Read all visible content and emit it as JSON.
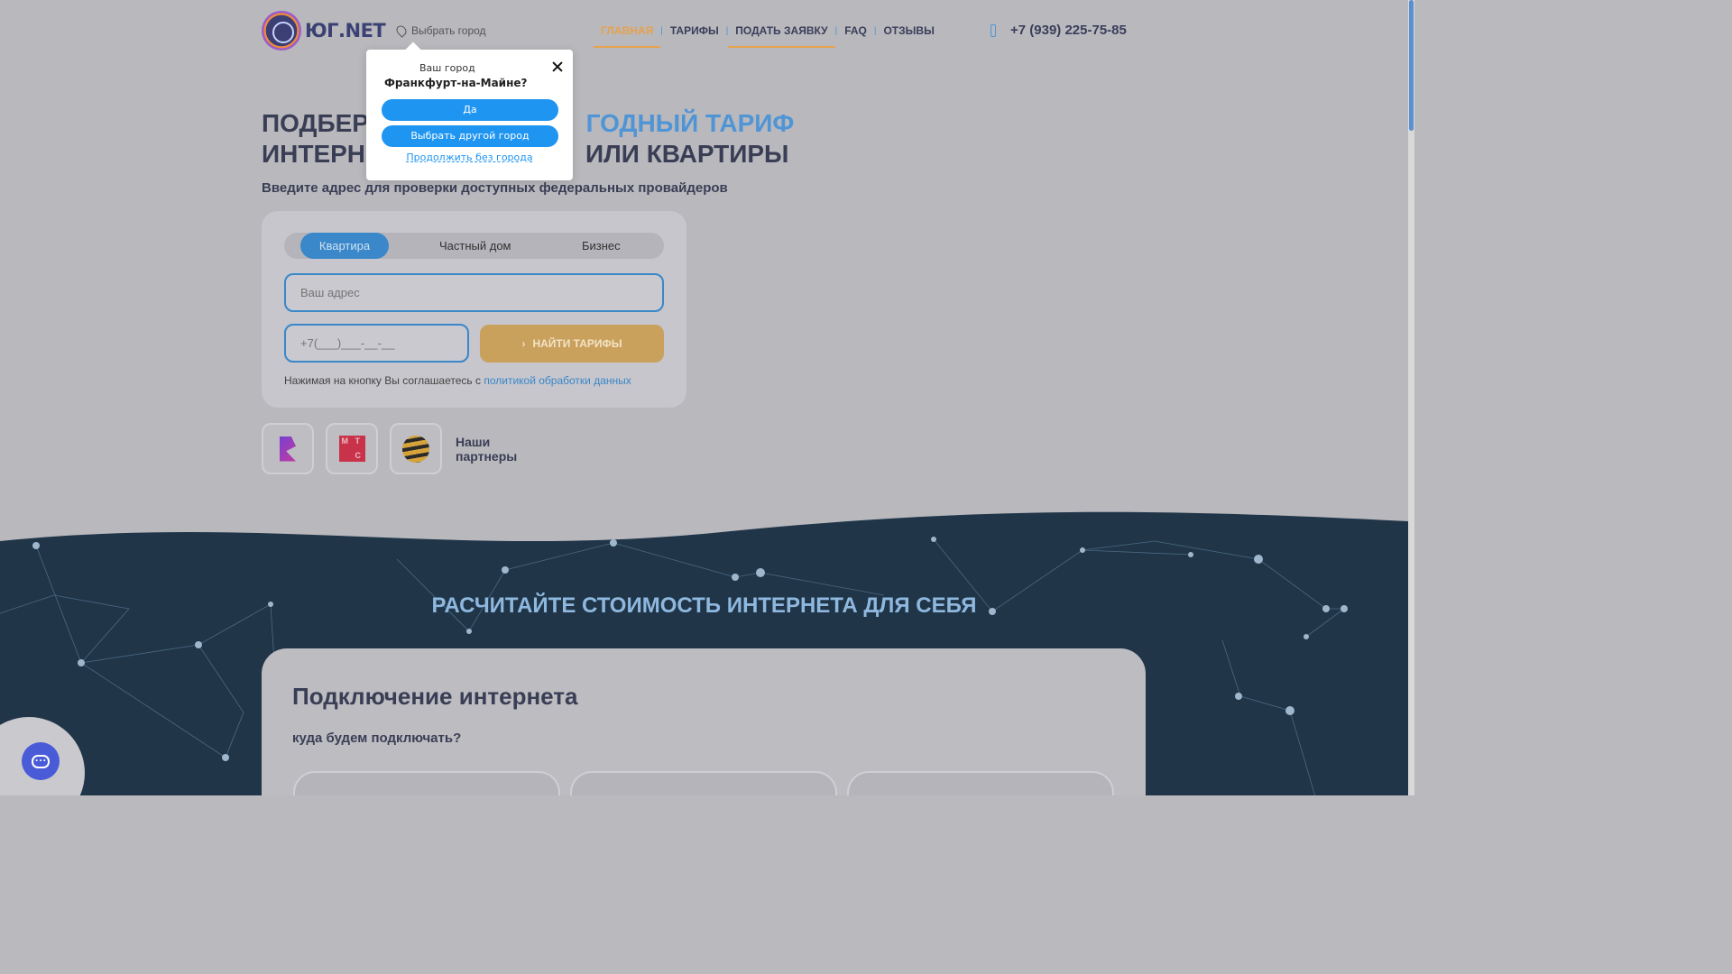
{
  "header": {
    "logo_text": "ЮГ.NET",
    "city_button": "Выбрать город",
    "nav": [
      {
        "label": "ГЛАВНАЯ"
      },
      {
        "label": "ТАРИФЫ"
      },
      {
        "label": "ПОДАТЬ ЗАЯВКУ"
      },
      {
        "label": "FAQ"
      },
      {
        "label": "ОТЗЫВЫ"
      }
    ],
    "phone": "+7 (939) 225-75-85"
  },
  "hero": {
    "title_line1_a": "ПОДБЕРЕ",
    "title_line1_b": "ГОДНЫЙ ТАРИФ",
    "title_line2_a": "ИНТЕРН",
    "title_line2_b": "ИЛИ КВАРТИРЫ",
    "subtitle": "Введите адрес для проверки доступных федеральных провайдеров"
  },
  "form": {
    "tabs": [
      "Квартира",
      "Частный дом",
      "Бизнес"
    ],
    "active_tab": "Квартира",
    "address_placeholder": "Ваш адрес",
    "phone_placeholder": "+7(___)___-__-__",
    "submit_label": "НАЙТИ ТАРИФЫ",
    "agree_text": "Нажимая на кнопку Вы соглашаетесь с",
    "agree_link": "политикой обработки данных"
  },
  "partners": {
    "label_line1": "Наши",
    "label_line2": "партнеры",
    "mts_letters": [
      "М",
      "Т",
      "С"
    ]
  },
  "calc": {
    "section_title": "РАСЧИТАЙТЕ СТОИМОСТЬ ИНТЕРНЕТА ДЛЯ СЕБЯ",
    "card_title": "Подключение интернета",
    "question": "куда будем подключать?"
  },
  "popup": {
    "label": "Ваш город",
    "city": "Франкфурт-на-Майне?",
    "yes_button": "Да",
    "other_city_button": "Выбрать другой город",
    "continue_link": "Продолжить без города"
  },
  "colors": {
    "accent_blue": "#3a87c9",
    "accent_orange": "#e7a24c",
    "popup_button": "#1f95f2",
    "dark_section": "#1f3447"
  }
}
